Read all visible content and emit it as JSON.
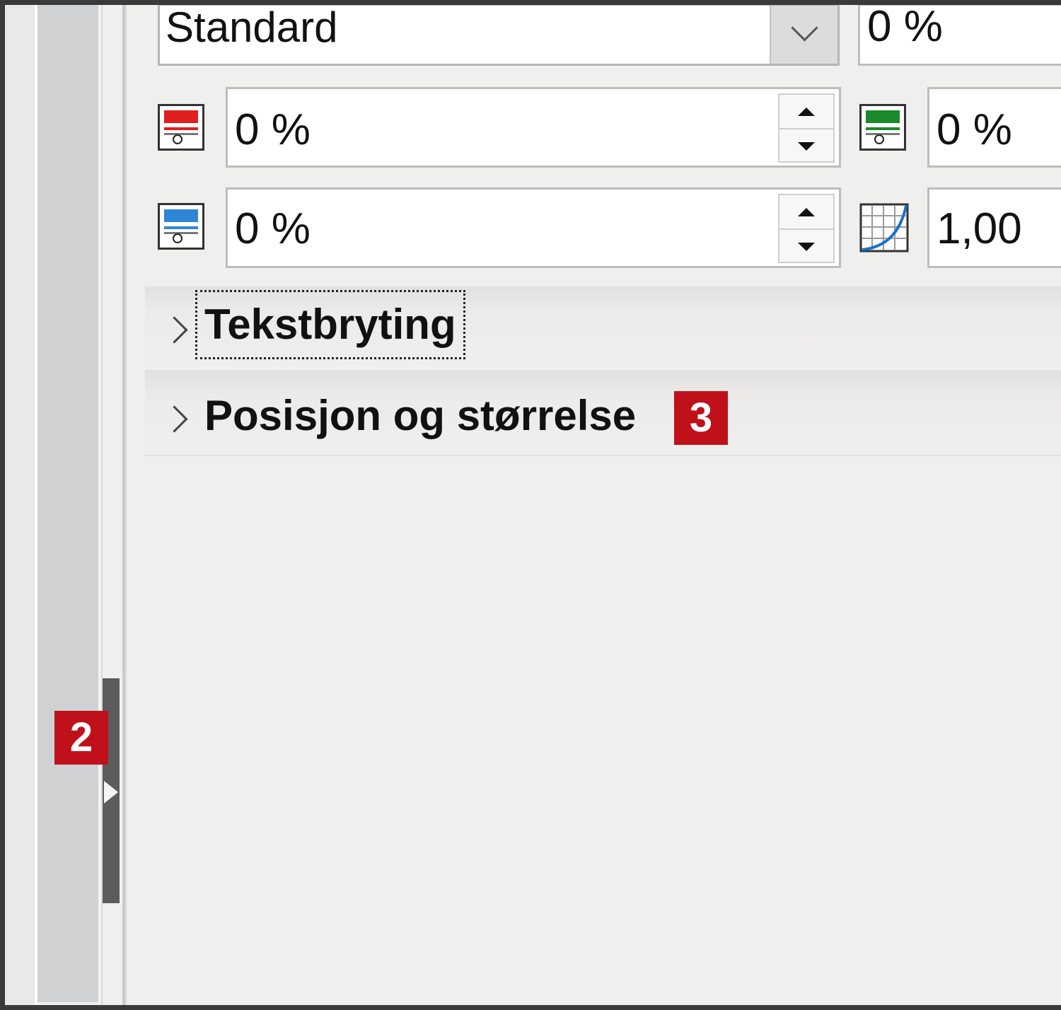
{
  "combo": {
    "value": "Standard"
  },
  "top_right_field": {
    "value": "0 %"
  },
  "channels": {
    "red": {
      "value": "0 %",
      "color": "#e01f1f",
      "icon": "red-channel-icon"
    },
    "green": {
      "value": "0 %",
      "color": "#1a8a2a",
      "icon": "green-channel-icon"
    },
    "blue": {
      "value": "0 %",
      "color": "#2d86d6",
      "icon": "blue-channel-icon"
    },
    "gamma": {
      "value": "1,00",
      "icon": "gamma-curve-icon"
    }
  },
  "sections": [
    {
      "label": "Tekstbryting"
    },
    {
      "label": "Posisjon og størrelse"
    }
  ],
  "badges": {
    "section_badge": "3",
    "side_badge": "2"
  },
  "colors": {
    "badge": "#c0101a"
  }
}
